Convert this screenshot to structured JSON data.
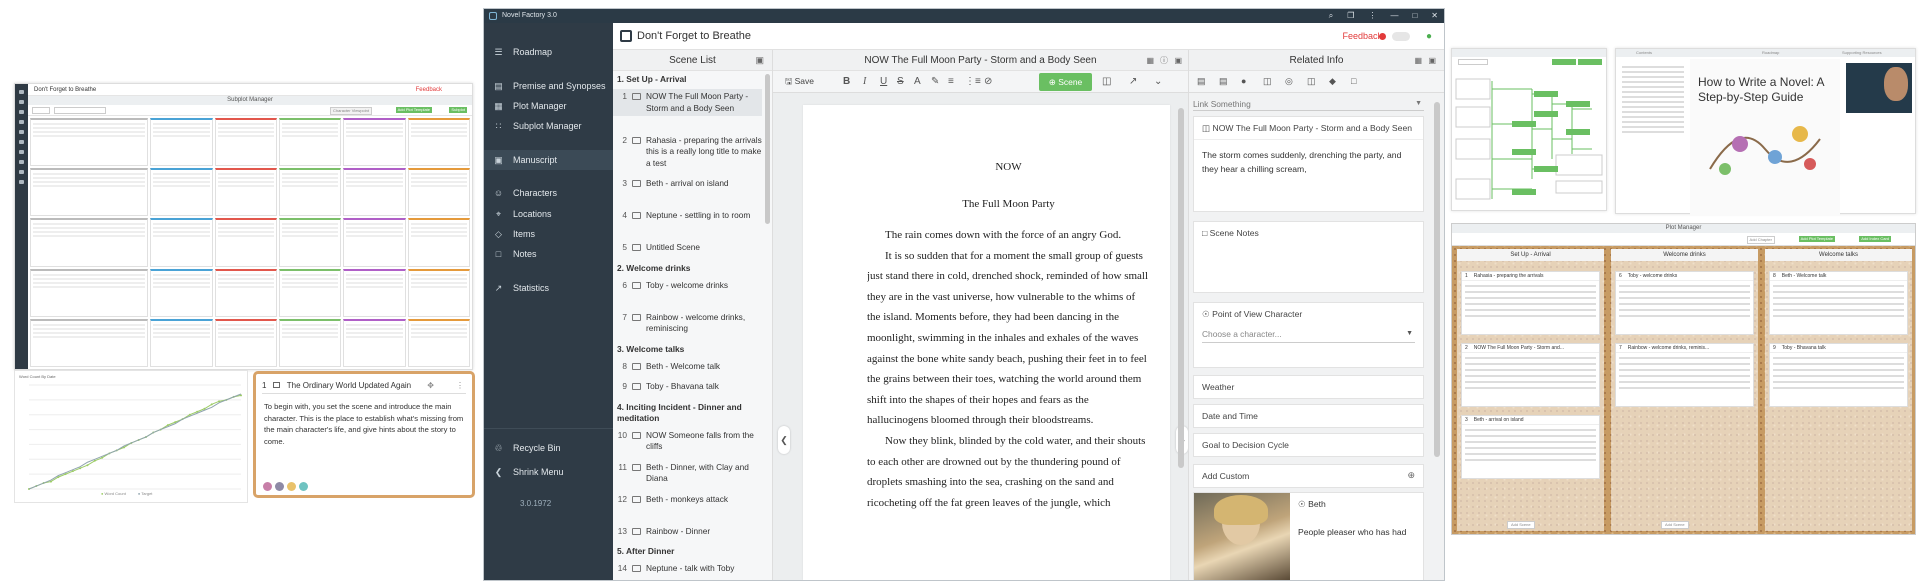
{
  "subplot_manager": {
    "app_title": "Don't Forget to Breathe",
    "panel_title": "Subplot Manager",
    "feedback": "Feedback",
    "buttons": [
      "Character Viewpoint",
      "Add Plot Template",
      "Subplot"
    ]
  },
  "word_count": {
    "title": "Word Count By Date",
    "legend": [
      "Word Count",
      "Target"
    ],
    "chart_data": {
      "type": "line",
      "title": "Word Count By Date",
      "series": [
        {
          "name": "Word Count",
          "values": [
            0,
            2,
            4,
            5,
            8,
            10,
            12,
            14,
            16,
            19,
            21,
            24,
            26,
            28,
            31,
            33,
            35,
            38,
            40,
            43,
            45,
            47,
            50,
            52,
            54,
            57,
            59,
            60,
            62,
            63
          ]
        },
        {
          "name": "Target",
          "values": [
            0,
            2,
            4,
            6,
            9,
            11,
            13,
            15,
            18,
            20,
            22,
            24,
            26,
            29,
            31,
            33,
            35,
            38,
            40,
            42,
            44,
            47,
            49,
            51,
            53,
            55,
            58,
            60,
            62,
            64
          ]
        }
      ],
      "colors": {
        "Word Count": "#9ccc65",
        "Target": "#90a4ae"
      },
      "grid": true,
      "legend_position": "bottom"
    }
  },
  "orange_card": {
    "number": "1",
    "title": "The Ordinary World Updated Again",
    "body": "To begin with, you set the scene and introduce the main character. This is the place to establish what's missing from the main character's life, and give hints about the story to come.",
    "dot_colors": [
      "#c77fa8",
      "#8e8aa6",
      "#e9c26b",
      "#6fc3c1"
    ],
    "border_color": "#d8a368"
  },
  "app": {
    "window_title": "Novel Factory 3.0",
    "window_controls": [
      "⌕",
      "❐",
      "⋮",
      "—",
      "□",
      "✕"
    ],
    "project_title": "Don't Forget to Breathe",
    "feedback": "Feedback",
    "version": "3.0.1972",
    "nav": [
      {
        "label": "Roadmap",
        "icon": "☰"
      },
      {
        "label": "Premise and Synopses",
        "icon": "▤"
      },
      {
        "label": "Plot Manager",
        "icon": "▦"
      },
      {
        "label": "Subplot Manager",
        "icon": "∷"
      },
      {
        "label": "Manuscript",
        "icon": "▣"
      },
      {
        "label": "Characters",
        "icon": "☺"
      },
      {
        "label": "Locations",
        "icon": "⌖"
      },
      {
        "label": "Items",
        "icon": "◇"
      },
      {
        "label": "Notes",
        "icon": "□"
      },
      {
        "label": "Statistics",
        "icon": "↗"
      },
      {
        "label": "Recycle Bin",
        "icon": "♲"
      },
      {
        "label": "Shrink Menu",
        "icon": "❮"
      }
    ],
    "scene_list": {
      "title": "Scene List",
      "sections": [
        {
          "title": "1. Set Up - Arrival",
          "scenes": [
            {
              "n": "1",
              "t": "NOW The Full Moon Party - Storm and a Body Seen",
              "sel": true
            },
            {
              "n": "2",
              "t": "Rahasia - preparing the arrivals this is a really long title to make a test"
            },
            {
              "n": "3",
              "t": "Beth - arrival on island"
            },
            {
              "n": "4",
              "t": "Neptune - settling in to room"
            },
            {
              "n": "5",
              "t": "Untitled Scene"
            }
          ]
        },
        {
          "title": "2. Welcome drinks",
          "scenes": [
            {
              "n": "6",
              "t": "Toby - welcome drinks"
            },
            {
              "n": "7",
              "t": "Rainbow - welcome drinks, reminiscing"
            }
          ]
        },
        {
          "title": "3. Welcome talks",
          "scenes": [
            {
              "n": "8",
              "t": "Beth - Welcome talk"
            },
            {
              "n": "9",
              "t": "Toby - Bhavana talk"
            }
          ]
        },
        {
          "title": "4. Inciting Incident - Dinner and meditation",
          "scenes": [
            {
              "n": "10",
              "t": "NOW Someone falls from the cliffs"
            },
            {
              "n": "11",
              "t": "Beth - Dinner, with Clay and Diana"
            },
            {
              "n": "12",
              "t": "Beth - monkeys attack"
            },
            {
              "n": "13",
              "t": "Rainbow - Dinner"
            }
          ]
        },
        {
          "title": "5. After Dinner",
          "scenes": [
            {
              "n": "14",
              "t": "Neptune - talk with Toby"
            }
          ]
        }
      ]
    },
    "editor": {
      "title": "NOW The Full Moon Party - Storm and a Body Seen",
      "save": "Save",
      "scene_button": "Scene",
      "heading1": "NOW",
      "heading2": "The Full Moon Party",
      "paragraphs": [
        "The rain comes down with the force of an angry God.",
        "It is so sudden that for a moment the small group of guests just stand there in cold, drenched shock, reminded of how small they are in the vast universe, how vulnerable to the whims of the island. Moments before, they had been dancing in the moonlight, swimming in the inhales and exhales of the waves against the bone white sandy beach, pushing their feet in to feel the grains between their toes, watching the world around them shift into the shapes of their hopes and fears as the hallucinogens bloomed through their bloodstreams.",
        "Now they blink, blinded by the cold water, and their shouts to each other are drowned out by the thundering pound of droplets smashing into the sea, crashing on the sand and ricocheting off the fat green leaves of the jungle, which"
      ]
    },
    "related_info": {
      "title": "Related Info",
      "link_placeholder": "Link Something",
      "scene_card_title": "NOW The Full Moon Party - Storm and a Body Seen",
      "scene_card_body": "The storm comes suddenly, drenching the party, and they hear a chilling scream,",
      "scene_notes": "Scene Notes",
      "pov_label": "Point of View Character",
      "pov_placeholder": "Choose a character...",
      "fields": [
        "Weather",
        "Date and Time",
        "Goal to Decision Cycle"
      ],
      "add_custom": "Add Custom",
      "character_name": "Beth",
      "character_desc": "People pleaser who has had"
    }
  },
  "roadmap_panel": {
    "title": "How to Write a Novel: A Step-by-Step Guide",
    "header": "Roadmap",
    "contents": "Contents",
    "supporting": "Supporting Resources"
  },
  "plot_manager": {
    "title": "Plot Manager",
    "buttons": [
      "Add Chapter",
      "Add Plot Template",
      "Add Index Card"
    ],
    "columns": [
      {
        "title": "Set Up - Arrival",
        "cards": [
          {
            "n": "1",
            "t": "Rahasia - preparing the arrivals"
          },
          {
            "n": "2",
            "t": "NOW The Full Moon Party - Storm and..."
          },
          {
            "n": "3",
            "t": "Beth - arrival on island"
          }
        ]
      },
      {
        "title": "Welcome drinks",
        "cards": [
          {
            "n": "6",
            "t": "Toby - welcome drinks"
          },
          {
            "n": "7",
            "t": "Rainbow - welcome drinks, reminis..."
          }
        ]
      },
      {
        "title": "Welcome talks",
        "cards": [
          {
            "n": "8",
            "t": "Beth - Welcome talk"
          },
          {
            "n": "9",
            "t": "Toby - Bhavana talk"
          }
        ]
      }
    ],
    "add_scene": "Add Scene"
  },
  "colors": {
    "sidebar": "#2f3b46",
    "accent_green": "#6abf62",
    "feedback_red": "#e23a3a",
    "card_orange": "#d8a368"
  }
}
